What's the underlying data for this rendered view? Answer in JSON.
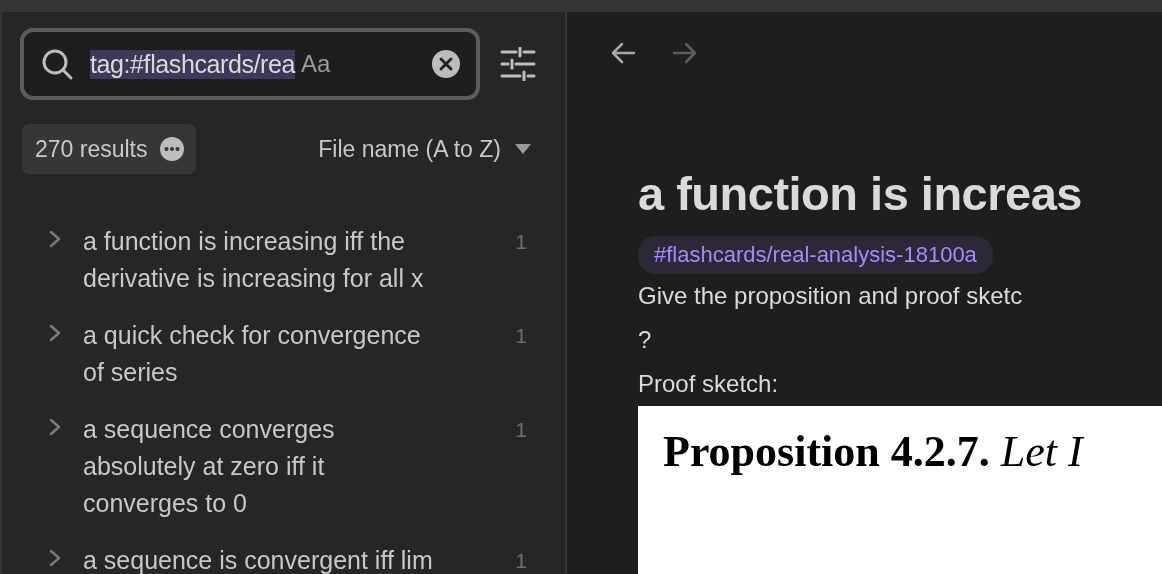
{
  "search": {
    "query": "tag:#flashcards/rea",
    "query_selected": true,
    "case_toggle": "Aa"
  },
  "results_bar": {
    "count": "270 results",
    "sort": "File name (A to Z)"
  },
  "results": [
    {
      "title": "a function is increasing iff the derivative is increasing for all x",
      "count": "1",
      "expanded": false
    },
    {
      "title": "a quick check for convergence of series",
      "count": "1",
      "expanded": false
    },
    {
      "title": "a sequence converges absolutely at zero iff it converges to 0",
      "count": "1",
      "expanded": false
    },
    {
      "title": "a sequence is convergent iff lim",
      "count": "1",
      "expanded": false
    }
  ],
  "note": {
    "title": "a function is increas",
    "tag": "#flashcards/real-analysis-18100a",
    "lines": [
      "Give the proposition and proof sketc",
      "?",
      "Proof sketch:"
    ],
    "embed": "**Proposition 4.2.7.** *Let I*"
  }
}
